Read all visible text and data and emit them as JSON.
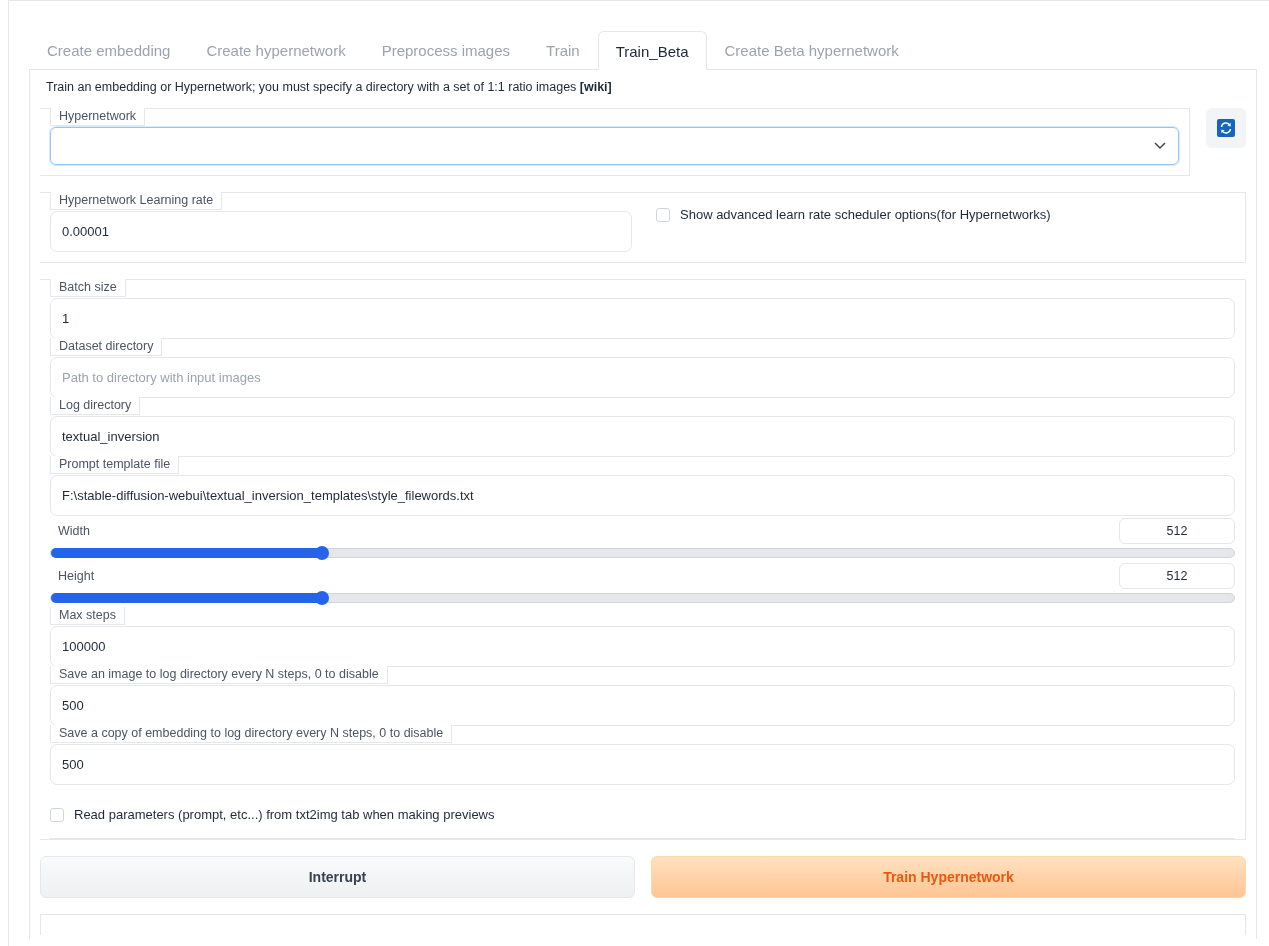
{
  "tabs": [
    {
      "label": "Create embedding",
      "selected": false
    },
    {
      "label": "Create hypernetwork",
      "selected": false
    },
    {
      "label": "Preprocess images",
      "selected": false
    },
    {
      "label": "Train",
      "selected": false
    },
    {
      "label": "Train_Beta",
      "selected": true
    },
    {
      "label": "Create Beta hypernetwork",
      "selected": false
    }
  ],
  "description": {
    "text": "Train an embedding or Hypernetwork; you must specify a directory with a set of 1:1 ratio images ",
    "link": "[wiki]"
  },
  "hypernetwork": {
    "label": "Hypernetwork",
    "expanded": false
  },
  "learning_rate": {
    "label": "Hypernetwork Learning rate",
    "value": "0.00001"
  },
  "scheduler_option": {
    "label": "Show advanced learn rate scheduler options(for Hypernetworks)",
    "checked": false
  },
  "fields": [
    {
      "kind": "text",
      "label": "Batch size",
      "value": "1"
    },
    {
      "kind": "text",
      "label": "Dataset directory",
      "placeholder": "Path to directory with input images"
    },
    {
      "kind": "text",
      "label": "Log directory",
      "value": "textual_inversion"
    },
    {
      "kind": "text",
      "label": "Prompt template file",
      "value": "F:\\stable-diffusion-webui\\textual_inversion_templates\\style_filewords.txt"
    },
    {
      "kind": "slider",
      "label": "Width",
      "value": "512",
      "level": 0.229
    },
    {
      "kind": "slider",
      "label": "Height",
      "value": "512",
      "level": 0.229
    },
    {
      "kind": "text",
      "label": "Max steps",
      "value": "100000"
    },
    {
      "kind": "text",
      "label": "Save an image to log directory every N steps, 0 to disable",
      "value": "500"
    },
    {
      "kind": "text",
      "label": "Save a copy of embedding to log directory every N steps, 0 to disable",
      "value": "500"
    }
  ],
  "read_params": {
    "label": "Read parameters (prompt, etc...) from txt2img tab when making previews",
    "checked": false
  },
  "buttons": [
    {
      "label": "Interrupt",
      "kind": "secondary"
    },
    {
      "label": "Train Hypernetwork",
      "kind": "primary"
    }
  ]
}
